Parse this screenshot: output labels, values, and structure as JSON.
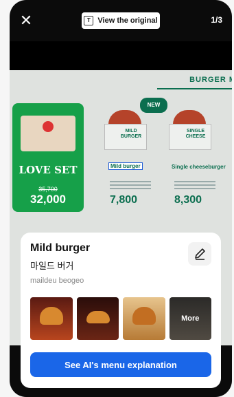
{
  "topbar": {
    "close_icon": "close-icon",
    "view_original_label": "View the original",
    "view_original_icon": "T",
    "page_counter": "1/3"
  },
  "menu_image": {
    "header": "BURGER M",
    "love_set": {
      "title": "LOVE SET",
      "old_price": "35,700",
      "price": "32,000"
    },
    "new_badge": "NEW",
    "items": [
      {
        "box_text": "MILD BURGER",
        "name": "Mild burger",
        "price": "7,800"
      },
      {
        "box_text": "SINGLE CHEESE",
        "name": "Single cheeseburger",
        "price": "8,300"
      }
    ]
  },
  "sheet": {
    "title": "Mild burger",
    "korean": "마일드 버거",
    "romanization": "maildeu beogeo",
    "thumbnails": [
      "burger-photo",
      "burger-photo",
      "burger-photo",
      "more"
    ],
    "more_label": "More",
    "cta_label": "See AI's menu explanation"
  },
  "colors": {
    "accent": "#1a66e8",
    "brand_green": "#0b6e4f"
  }
}
